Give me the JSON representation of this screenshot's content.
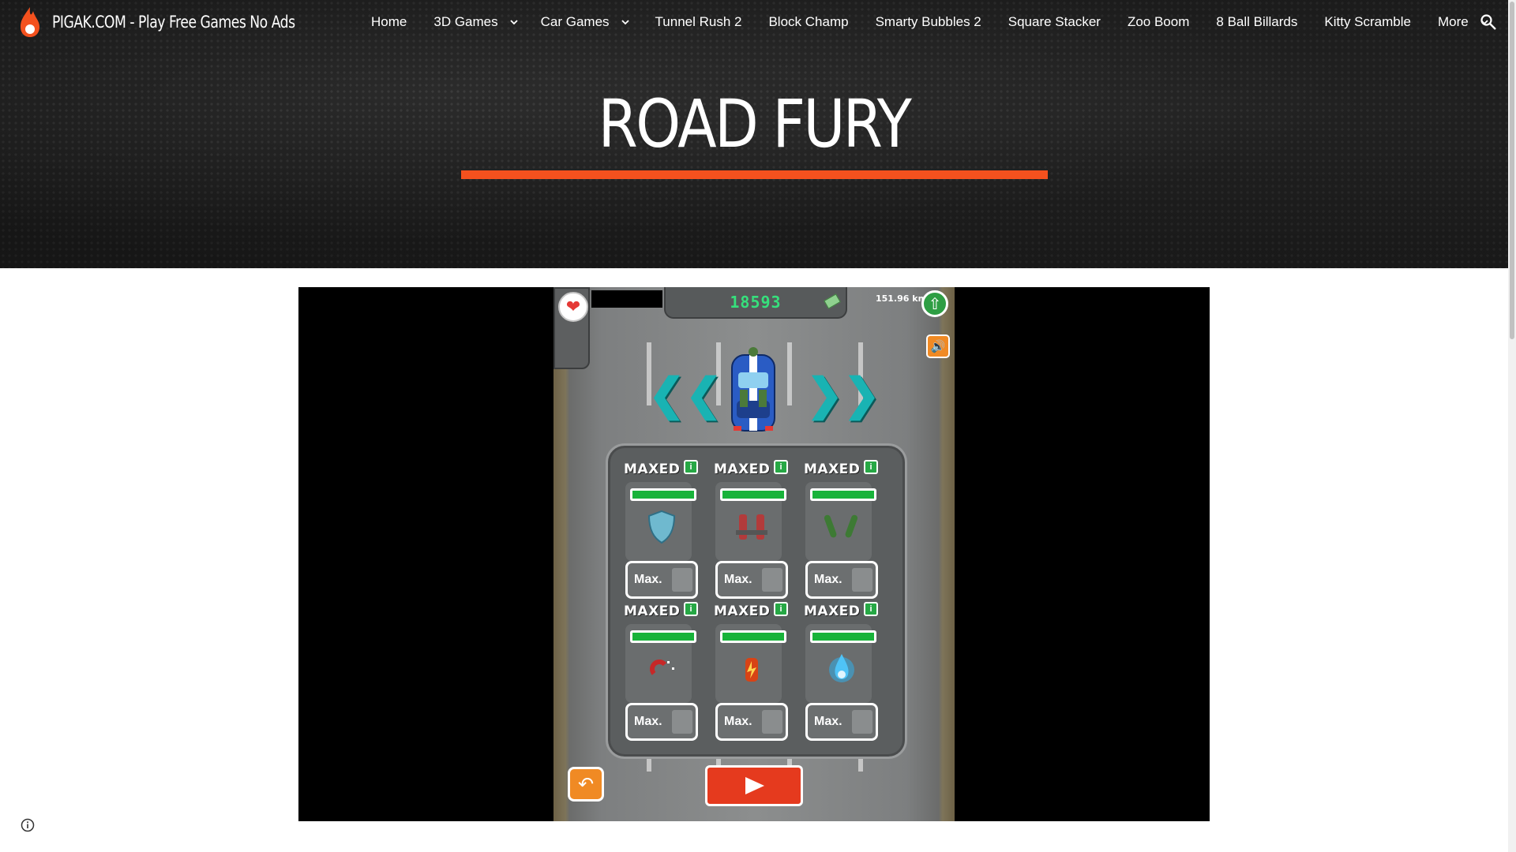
{
  "site": {
    "brand_name": "PIGAK.COM - Play Free Games No Ads",
    "colors": {
      "header_bg": "#2b2b2b",
      "accent": "#f4511e",
      "text": "#ffffff"
    }
  },
  "nav": {
    "items": [
      {
        "label": "Home",
        "dropdown": false
      },
      {
        "label": "3D Games",
        "dropdown": true
      },
      {
        "label": "Car Games",
        "dropdown": true
      },
      {
        "label": "Tunnel Rush 2",
        "dropdown": false
      },
      {
        "label": "Block Champ",
        "dropdown": false
      },
      {
        "label": "Smarty Bubbles 2",
        "dropdown": false
      },
      {
        "label": "Square Stacker",
        "dropdown": false
      },
      {
        "label": "Zoo Boom",
        "dropdown": false
      },
      {
        "label": "8 Ball Billards",
        "dropdown": false
      },
      {
        "label": "Kitty Scramble",
        "dropdown": false
      },
      {
        "label": "More",
        "dropdown": true
      }
    ],
    "search_icon": "search-icon"
  },
  "page": {
    "title": "ROAD FURY"
  },
  "game": {
    "score": "18593",
    "distance": "151.96 km",
    "icons": {
      "life": "heart-icon",
      "upgrade": "up-arrow-icon",
      "sound": "speaker-icon",
      "back": "back-arrow-icon",
      "play": "play-icon"
    },
    "upgrades": [
      {
        "status": "MAXED",
        "icon": "shield-icon",
        "level": 1.0,
        "button": "Max."
      },
      {
        "status": "MAXED",
        "icon": "guns-icon",
        "level": 1.0,
        "button": "Max."
      },
      {
        "status": "MAXED",
        "icon": "rockets-icon",
        "level": 1.0,
        "button": "Max."
      },
      {
        "status": "MAXED",
        "icon": "magnet-icon",
        "level": 1.0,
        "button": "Max."
      },
      {
        "status": "MAXED",
        "icon": "nitro-icon",
        "level": 1.0,
        "button": "Max."
      },
      {
        "status": "MAXED",
        "icon": "blue-flame-icon",
        "level": 1.0,
        "button": "Max."
      }
    ],
    "info_badge": "i"
  },
  "footer": {
    "info_icon": "info-icon"
  }
}
